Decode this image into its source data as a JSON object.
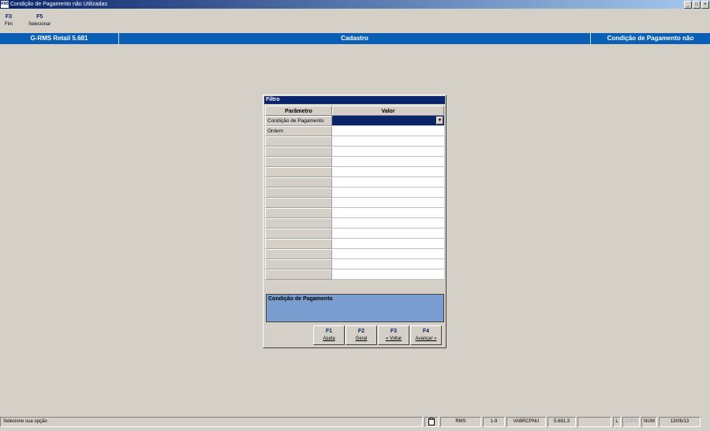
{
  "window": {
    "title": "Condição de Pagamento não Utilizadas",
    "icon": "app-icon",
    "app_icon_text": "RMS"
  },
  "window_controls": {
    "minimize": "_",
    "maximize": "□",
    "close": "×"
  },
  "toolbar": {
    "keys": [
      {
        "key": "F3",
        "label": "Fim"
      },
      {
        "key": "F5",
        "label": "Selecionar"
      }
    ]
  },
  "infobar": {
    "app": "G-RMS Retail 5.681",
    "module": "Cadastro",
    "screen": "Condição de Pagamento não"
  },
  "dialog": {
    "title": "Filtro",
    "columns": {
      "param": "Parâmetro",
      "value": "Valor"
    },
    "rows": [
      {
        "param": "Condição de Pagamento",
        "value": ""
      },
      {
        "param": "Ordem",
        "value": ""
      },
      {
        "param": "",
        "value": ""
      },
      {
        "param": "",
        "value": ""
      },
      {
        "param": "",
        "value": ""
      },
      {
        "param": "",
        "value": ""
      },
      {
        "param": "",
        "value": ""
      },
      {
        "param": "",
        "value": ""
      },
      {
        "param": "",
        "value": ""
      },
      {
        "param": "",
        "value": ""
      },
      {
        "param": "",
        "value": ""
      },
      {
        "param": "",
        "value": ""
      },
      {
        "param": "",
        "value": ""
      },
      {
        "param": "",
        "value": ""
      },
      {
        "param": "",
        "value": ""
      },
      {
        "param": "",
        "value": ""
      }
    ],
    "combo_arrow": "▼",
    "help_text": "Condição de Pagamento",
    "buttons": [
      {
        "key": "F1",
        "label": "Ajuda"
      },
      {
        "key": "F2",
        "label": "Geral"
      },
      {
        "key": "F3",
        "label": "« Voltar"
      },
      {
        "key": "F4",
        "label": "Avançar »"
      }
    ]
  },
  "statusbar": {
    "message": "Selecione sua opção",
    "system": "RMS",
    "range": "1-9",
    "program": "VABRCPNU",
    "version": "5.681.3",
    "lock": "L",
    "caps": "CAPS",
    "num": "NUM",
    "date": "13/06/13"
  },
  "colors": {
    "title_start": "#0a246a",
    "infobar": "#0a5fb4",
    "help_bg": "#7a9ccf",
    "selected": "#0a246a"
  }
}
